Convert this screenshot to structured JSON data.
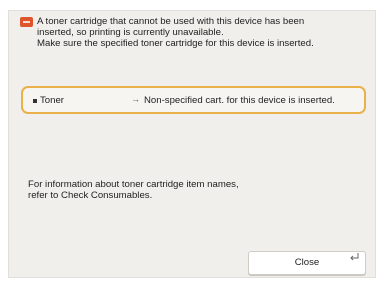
{
  "message": {
    "icon": "error-icon",
    "lines": [
      "A toner cartridge that cannot be used with this device has been",
      "inserted, so printing is currently unavailable.",
      "Make sure the specified toner cartridge for this device is inserted."
    ]
  },
  "status_item": {
    "name": "Toner",
    "arrow": "→",
    "status": "Non-specified cart. for this device is inserted."
  },
  "info": {
    "lines": [
      "For information about toner cartridge item names,",
      "refer to Check Consumables."
    ]
  },
  "close_button": {
    "label": "Close",
    "icon": "enter-icon"
  },
  "colors": {
    "panel_bg": "#f1efec",
    "highlight_border": "#eab04a",
    "error_icon": "#e0542c"
  }
}
